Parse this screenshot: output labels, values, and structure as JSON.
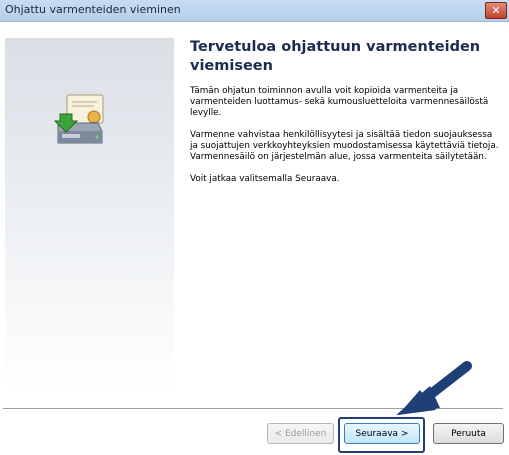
{
  "window": {
    "title": "Ohjattu varmenteiden vieminen",
    "close_glyph": "✕"
  },
  "content": {
    "heading": "Tervetuloa ohjattuun varmenteiden viemiseen",
    "paragraphs": [
      "Tämän ohjatun toiminnon avulla voit kopioida varmenteita ja varmenteiden luottamus- sekä kumousluetteloita varmennesäilöstä levylle.",
      "Varmenne vahvistaa henkilöllisyytesi ja sisältää tiedon suojauksessa ja suojattujen verkkoyhteyksien muodostamisessa käytettäviä tietoja. Varmennesäilö on järjestelmän alue, jossa varmenteita säilytetään.",
      "Voit jatkaa valitsemalla Seuraava."
    ]
  },
  "buttons": {
    "back": "< Edellinen",
    "next": "Seuraava >",
    "cancel": "Peruuta"
  },
  "icons": {
    "wizard": "certificate-export-icon",
    "callout": "arrow-pointer-icon"
  },
  "colors": {
    "titlebar": "#b6d0ec",
    "heading": "#1d2b50",
    "callout": "#1f3f77"
  }
}
